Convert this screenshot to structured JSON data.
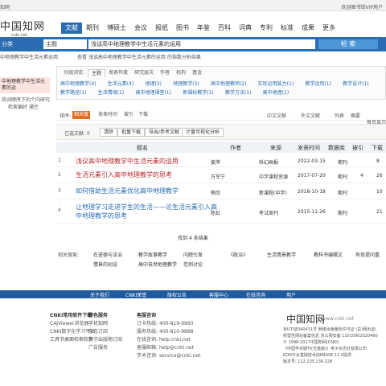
{
  "topbar": {
    "left": "知网",
    "right": "欢迎图书馆VIP用户"
  },
  "logo": {
    "zh": "中国知网",
    "en": "cnki.net"
  },
  "nav": {
    "tabs": [
      "文献",
      "期刊",
      "博硕士",
      "会议",
      "报纸",
      "图书",
      "年鉴",
      "百科",
      "词典",
      "专利",
      "标准",
      "成果",
      "更多"
    ],
    "active": 0
  },
  "search": {
    "category": "分类",
    "field": "主题",
    "query": "浅谈高中地理教学中生活元素的运用",
    "button": "检 索"
  },
  "crumbs": {
    "left": "中地理教学中生活元素运用",
    "right": "查看 浅谈高中地理教学中生活元素的运用 的指数分析结果"
  },
  "left_panel": {
    "highlight": "中地理教学中生活元素的运",
    "items": [
      "热词顺序下的个内研究",
      "检索偏好  通空"
    ]
  },
  "filter": {
    "tabs": [
      "分组浏览:",
      "主题",
      "发表年度",
      "研究层次",
      "作者",
      "机构",
      "基金"
    ],
    "active_tab": 1,
    "tags": [
      "高中地理教学(4)",
      "生活元素(4)",
      "地理(3)",
      "地理教学(3)",
      "高中地理教师(2)",
      "实际运用能力(1)",
      "教学运用(1)",
      "教学设计(1)",
      "教学路径(1)",
      "生活情境(1)",
      "高中地理课堂(1)",
      "新课标教学(1)",
      "教学方法(1)",
      "高中地理(1)"
    ]
  },
  "sort": {
    "label": "排序:",
    "options": [
      "相关度",
      "发表时间",
      "被引",
      "下载"
    ],
    "active": 0,
    "right": [
      "中文文献",
      "外文文献",
      "列表",
      "摘要",
      "每页显示"
    ]
  },
  "toolbar": {
    "selected": "已选文献:",
    "count": "0",
    "clear": "清除",
    "buttons": [
      "批量下载",
      "导出/参考文献",
      "计量可视化分析"
    ],
    "page": "找到 4 条结果"
  },
  "table": {
    "headers": [
      "题名",
      "作者",
      "来源",
      "发表时间",
      "数据库",
      "被引",
      "下载"
    ],
    "rows": [
      {
        "num": "1",
        "title": "浅议高中地理教学中生活元素的运用",
        "author": "姜萍",
        "source": "科幻画报",
        "date": "2022-03-15",
        "db": "期刊",
        "cited": "",
        "down": "8"
      },
      {
        "num": "2",
        "title": "生活元素引入高中地理教学的思考",
        "author": "万军宁",
        "source": "中学课程资源",
        "date": "2017-07-20",
        "db": "期刊",
        "cited": "4",
        "down": "26"
      },
      {
        "num": "3",
        "title": "如何借助生活元素优化高中地理教学",
        "author": "熊欣",
        "source": "新课程(中学)",
        "date": "2018-10-18",
        "db": "期刊",
        "cited": "",
        "down": "10"
      },
      {
        "num": "4",
        "title": "让地理学习走进学生的生活——论生活元素引入高中地理教学的思考",
        "author": "陈虹",
        "source": "考试周刊",
        "date": "2015-11-26",
        "db": "期刊",
        "cited": "",
        "down": "21"
      }
    ]
  },
  "found": "找到 4 条结果",
  "related": {
    "label": "相关搜索:",
    "items": [
      "在道德与法治",
      "教学故事教学",
      "问题引发",
      "《政治》",
      "生活情景教学",
      "教科书编辑文",
      "有效提问重",
      "情景的创设",
      "高中自然地理教学",
      "范例讨论"
    ]
  },
  "bluebar": [
    "关于我们",
    "CNKI荣誉",
    "版权公告",
    "客服中心",
    "在线咨询",
    "用户"
  ],
  "footer": {
    "col1": {
      "h": "CNKI常用软件下载",
      "items": [
        "CAJViewer浏览器",
        "CNKI数字化学习平台",
        "工具书桌面检索软件"
      ]
    },
    "col2": {
      "h": "特色服务",
      "items": [
        "手机知网",
        "杂志订阅",
        "数字出版物订阅",
        "广告服务"
      ]
    },
    "col3": {
      "h": "客服咨询",
      "items": [
        "订卡热线:",
        "服务热线:",
        "在线咨询:",
        "客服邮箱:",
        "学术咨询:"
      ]
    },
    "col4": {
      "items": [
        "400-819-9993",
        "400-810-9888",
        "help.cnki.net",
        "help@cnki.net",
        "service@cnki.net"
      ]
    },
    "logo": "中国知网",
    "url": "www.cnki.net",
    "info": [
      "京ICP证040431号 网络出版服务许可证 (总)网出证(",
      "经营性网站备案信息 京公网安备 11010802020460",
      "© 1998-2017中国知网(CNKI)",
      "《中国学术期刊(光盘版)》电子杂志社有限公司",
      "KDN平台基础技术由KBASE 11.0提供.",
      "版本号: 112.235.139.228"
    ]
  }
}
